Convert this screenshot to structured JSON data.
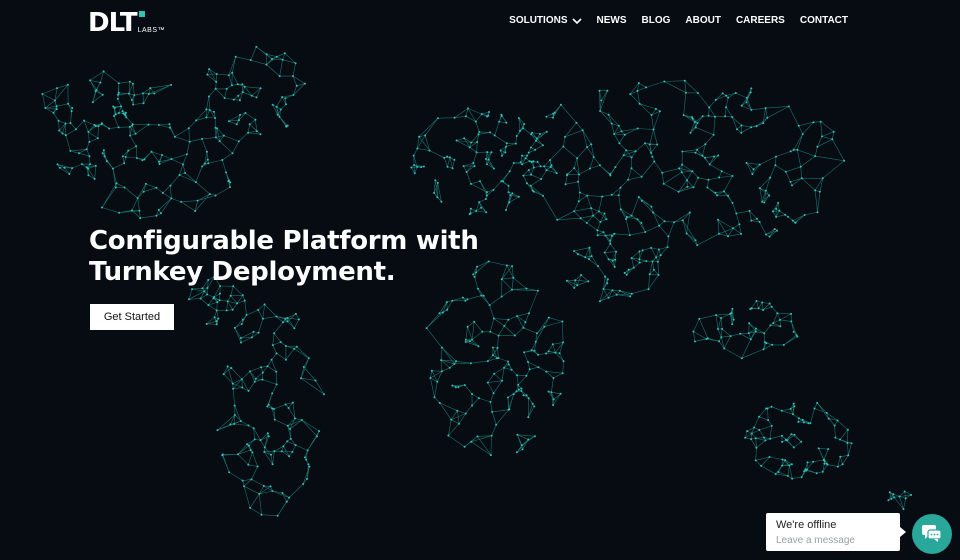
{
  "header": {
    "logo_text": "DLT",
    "logo_sub": "LABS™",
    "nav": [
      {
        "label": "SOLUTIONS",
        "icon": "chevron-down-icon"
      },
      {
        "label": "NEWS"
      },
      {
        "label": "BLOG"
      },
      {
        "label": "ABOUT"
      },
      {
        "label": "CAREERS"
      },
      {
        "label": "CONTACT"
      }
    ]
  },
  "hero": {
    "title_line1": "Configurable Platform with",
    "title_line2": "Turnkey Deployment.",
    "cta_label": "Get Started"
  },
  "chat": {
    "status": "We're offline",
    "prompt": "Leave a message",
    "icon": "chat-icon"
  },
  "colors": {
    "background": "#070c13",
    "accent": "#2ec4b6",
    "chat_button": "#29a79a"
  }
}
